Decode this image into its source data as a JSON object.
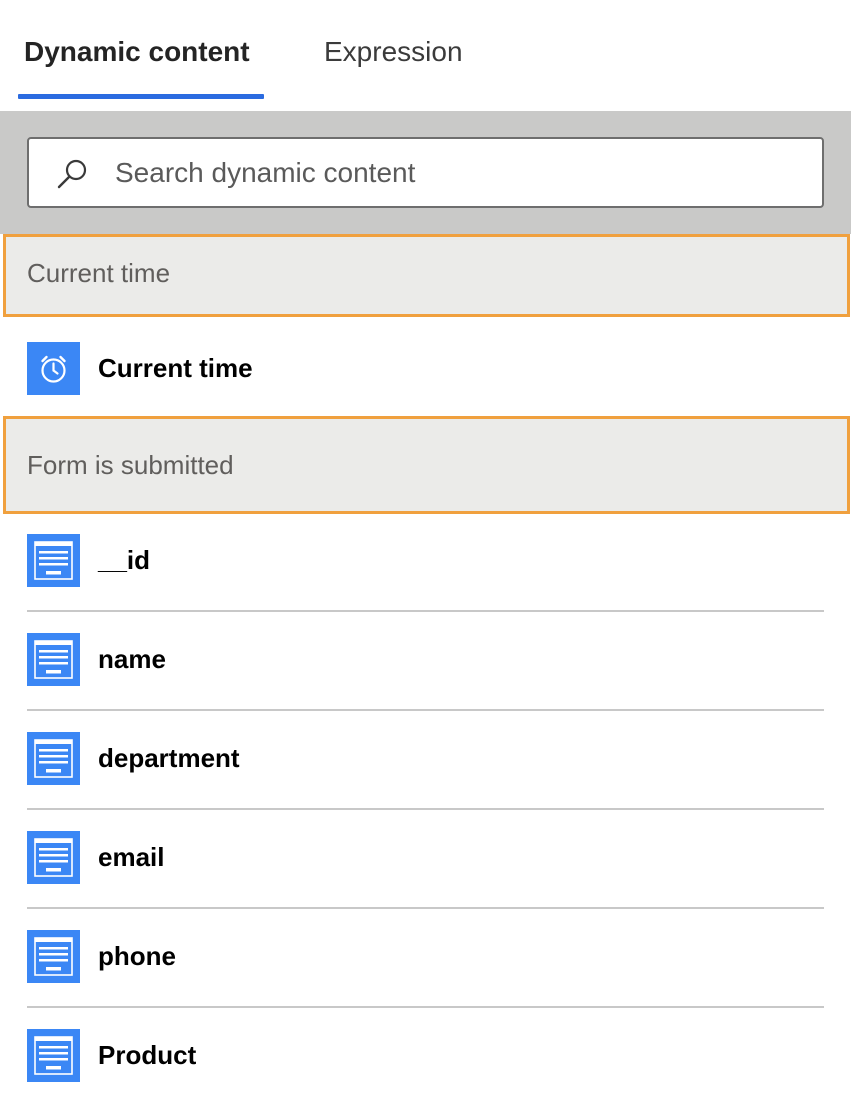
{
  "tabs": {
    "dynamic_content": "Dynamic content",
    "expression": "Expression",
    "active": "dynamic_content"
  },
  "search": {
    "placeholder": "Search dynamic content",
    "value": ""
  },
  "sections": [
    {
      "header": "Current time",
      "items": [
        {
          "label": "Current time",
          "icon": "alarm-clock-icon"
        }
      ]
    },
    {
      "header": "Form is submitted",
      "items": [
        {
          "label": "__id",
          "icon": "form-icon"
        },
        {
          "label": "name",
          "icon": "form-icon"
        },
        {
          "label": "department",
          "icon": "form-icon"
        },
        {
          "label": "email",
          "icon": "form-icon"
        },
        {
          "label": "phone",
          "icon": "form-icon"
        },
        {
          "label": "Product",
          "icon": "form-icon"
        }
      ]
    }
  ],
  "colors": {
    "accent": "#2b6be0",
    "highlight_border": "#f0a03e",
    "icon_blue": "#3b87f5",
    "search_band": "#c9c9c8",
    "section_bg": "#ebebe9"
  }
}
